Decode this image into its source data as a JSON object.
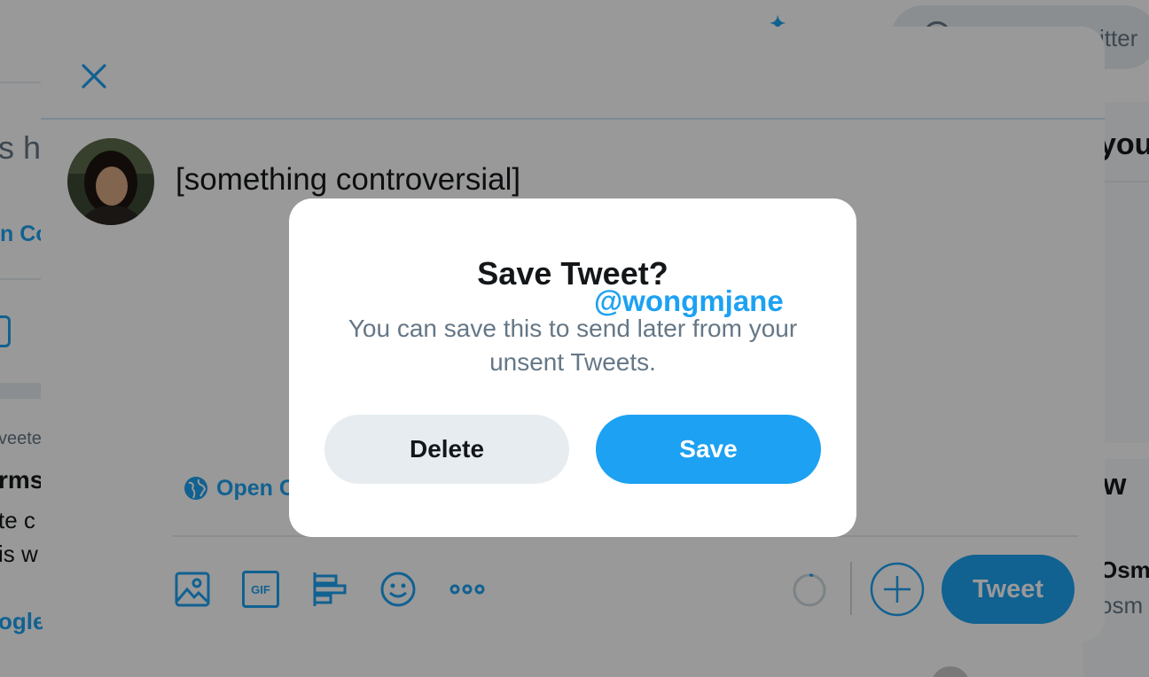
{
  "background": {
    "search_placeholder": "itter",
    "fragments": {
      "left_heading": "s ha",
      "left_link": "n Co",
      "retweeted": "veete",
      "terms": "rms",
      "line_a": "te c",
      "line_b": "is w",
      "google": "ogle",
      "right_heading": "you",
      "who_to_follow": "w",
      "name": "Osm",
      "handle": "osm"
    }
  },
  "composer": {
    "tweet_text": "[something controversial]",
    "audience_label": "Open C",
    "tweet_button_label": "Tweet",
    "tools": [
      "image-icon",
      "gif-icon",
      "poll-icon",
      "emoji-icon",
      "more-icon"
    ],
    "gif_icon_text": "GIF"
  },
  "dialog": {
    "title": "Save Tweet?",
    "message": "You can save this to send later from your unsent Tweets.",
    "delete_label": "Delete",
    "save_label": "Save"
  },
  "watermark": "@wongmjane",
  "colors": {
    "accent": "#1da1f2",
    "text_primary": "#14171a",
    "text_secondary": "#657786",
    "secondary_button": "#e6ecf0"
  }
}
